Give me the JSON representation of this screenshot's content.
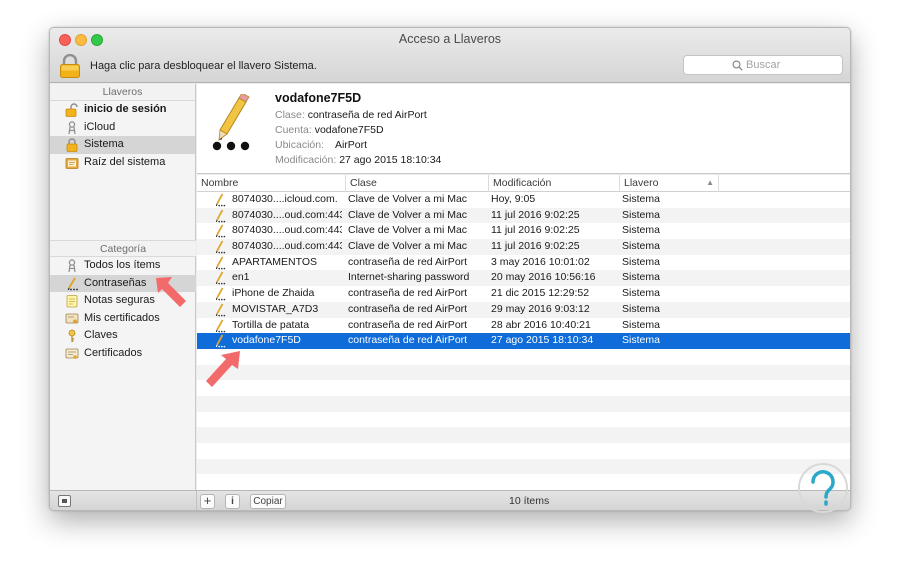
{
  "window": {
    "title": "Acceso a Llaveros"
  },
  "toolbar": {
    "lock_message": "Haga clic para desbloquear el llavero Sistema.",
    "search_placeholder": "Buscar"
  },
  "sidebar": {
    "keychains_header": "Llaveros",
    "keychains": [
      {
        "label": "inicio de sesión",
        "icon": "unlocked-padlock-icon",
        "bold": true
      },
      {
        "label": "iCloud",
        "icon": "keychain-icon"
      },
      {
        "label": "Sistema",
        "icon": "padlock-icon",
        "selected": true
      },
      {
        "label": "Raíz del sistema",
        "icon": "certificate-folder-icon"
      }
    ],
    "category_header": "Categoría",
    "categories": [
      {
        "label": "Todos los ítems",
        "icon": "keys-icon"
      },
      {
        "label": "Contraseñas",
        "icon": "password-pencil-icon",
        "selected": true
      },
      {
        "label": "Notas seguras",
        "icon": "note-icon"
      },
      {
        "label": "Mis certificados",
        "icon": "my-certificate-icon"
      },
      {
        "label": "Claves",
        "icon": "key-icon"
      },
      {
        "label": "Certificados",
        "icon": "certificate-icon"
      }
    ]
  },
  "detail": {
    "name": "vodafone7F5D",
    "class_label": "Clase:",
    "class_value": "contraseña de red AirPort",
    "account_label": "Cuenta:",
    "account_value": "vodafone7F5D",
    "location_label": "Ubicación:",
    "location_value": "AirPort",
    "modified_label": "Modificación:",
    "modified_value": "27 ago 2015 18:10:34"
  },
  "table": {
    "columns": [
      "Nombre",
      "Clase",
      "Modificación",
      "Llavero"
    ],
    "rows": [
      {
        "name": "8074030....icloud.com.",
        "kind": "Clave de Volver a mi Mac",
        "date": "Hoy, 9:05",
        "keychain": "Sistema"
      },
      {
        "name": "8074030....oud.com:443",
        "kind": "Clave de Volver a mi Mac",
        "date": "11 jul 2016 9:02:25",
        "keychain": "Sistema"
      },
      {
        "name": "8074030....oud.com:443",
        "kind": "Clave de Volver a mi Mac",
        "date": "11 jul 2016 9:02:25",
        "keychain": "Sistema"
      },
      {
        "name": "8074030....oud.com:443",
        "kind": "Clave de Volver a mi Mac",
        "date": "11 jul 2016 9:02:25",
        "keychain": "Sistema"
      },
      {
        "name": "APARTAMENTOS",
        "kind": "contraseña de red AirPort",
        "date": "3 may 2016 10:01:02",
        "keychain": "Sistema"
      },
      {
        "name": "en1",
        "kind": "Internet-sharing password",
        "date": "20 may 2016 10:56:16",
        "keychain": "Sistema"
      },
      {
        "name": "iPhone de Zhaida",
        "kind": "contraseña de red AirPort",
        "date": "21 dic 2015 12:29:52",
        "keychain": "Sistema"
      },
      {
        "name": "MOVISTAR_A7D3",
        "kind": "contraseña de red AirPort",
        "date": "29 may 2016 9:03:12",
        "keychain": "Sistema"
      },
      {
        "name": "Tortilla de patata",
        "kind": "contraseña de red AirPort",
        "date": "28 abr 2016 10:40:21",
        "keychain": "Sistema"
      },
      {
        "name": "vodafone7F5D",
        "kind": "contraseña de red AirPort",
        "date": "27 ago 2015 18:10:34",
        "keychain": "Sistema",
        "selected": true
      }
    ]
  },
  "bottombar": {
    "add_label": "+",
    "info_label": "i",
    "copy_label": "Copiar",
    "count": "10 ítems"
  },
  "colors": {
    "selection": "#0f6cd9",
    "annotation_arrow": "#f26a6a",
    "watermark": "#2aa7c9"
  }
}
